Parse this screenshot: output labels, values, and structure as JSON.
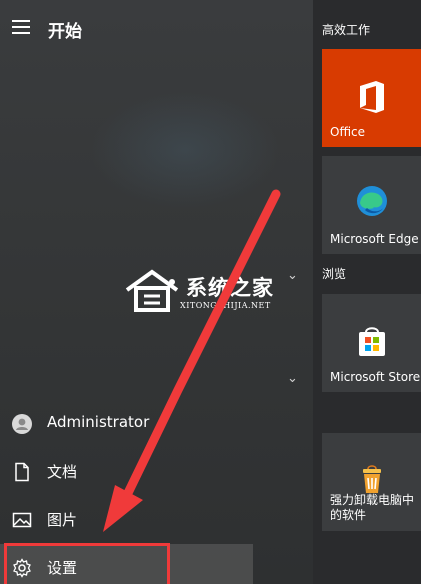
{
  "header": {
    "title": "开始",
    "menu_icon": "hamburger-icon"
  },
  "sections": {
    "productivity": "高效工作",
    "browse": "浏览"
  },
  "tiles": [
    {
      "label": "Office",
      "icon": "office-icon",
      "color": "#d83b01"
    },
    {
      "label": "Microsoft Edge",
      "icon": "edge-icon",
      "color": "#3b3d3f"
    },
    {
      "label": "Microsoft Store",
      "icon": "store-icon",
      "color": "#3b3d3f"
    },
    {
      "label": "强力卸载电脑中的软件",
      "icon": "uninstaller-icon",
      "color": "#3b3d3f"
    }
  ],
  "nav": {
    "user": {
      "label": "Administrator",
      "icon": "user-avatar-icon"
    },
    "documents": {
      "label": "文档",
      "icon": "document-icon"
    },
    "pictures": {
      "label": "图片",
      "icon": "picture-icon"
    },
    "settings": {
      "label": "设置",
      "icon": "gear-icon"
    }
  },
  "watermark": {
    "main": "系统之家",
    "sub": "XITONGZHIJIA.NET"
  },
  "annotation": {
    "color": "#f03a3a"
  }
}
